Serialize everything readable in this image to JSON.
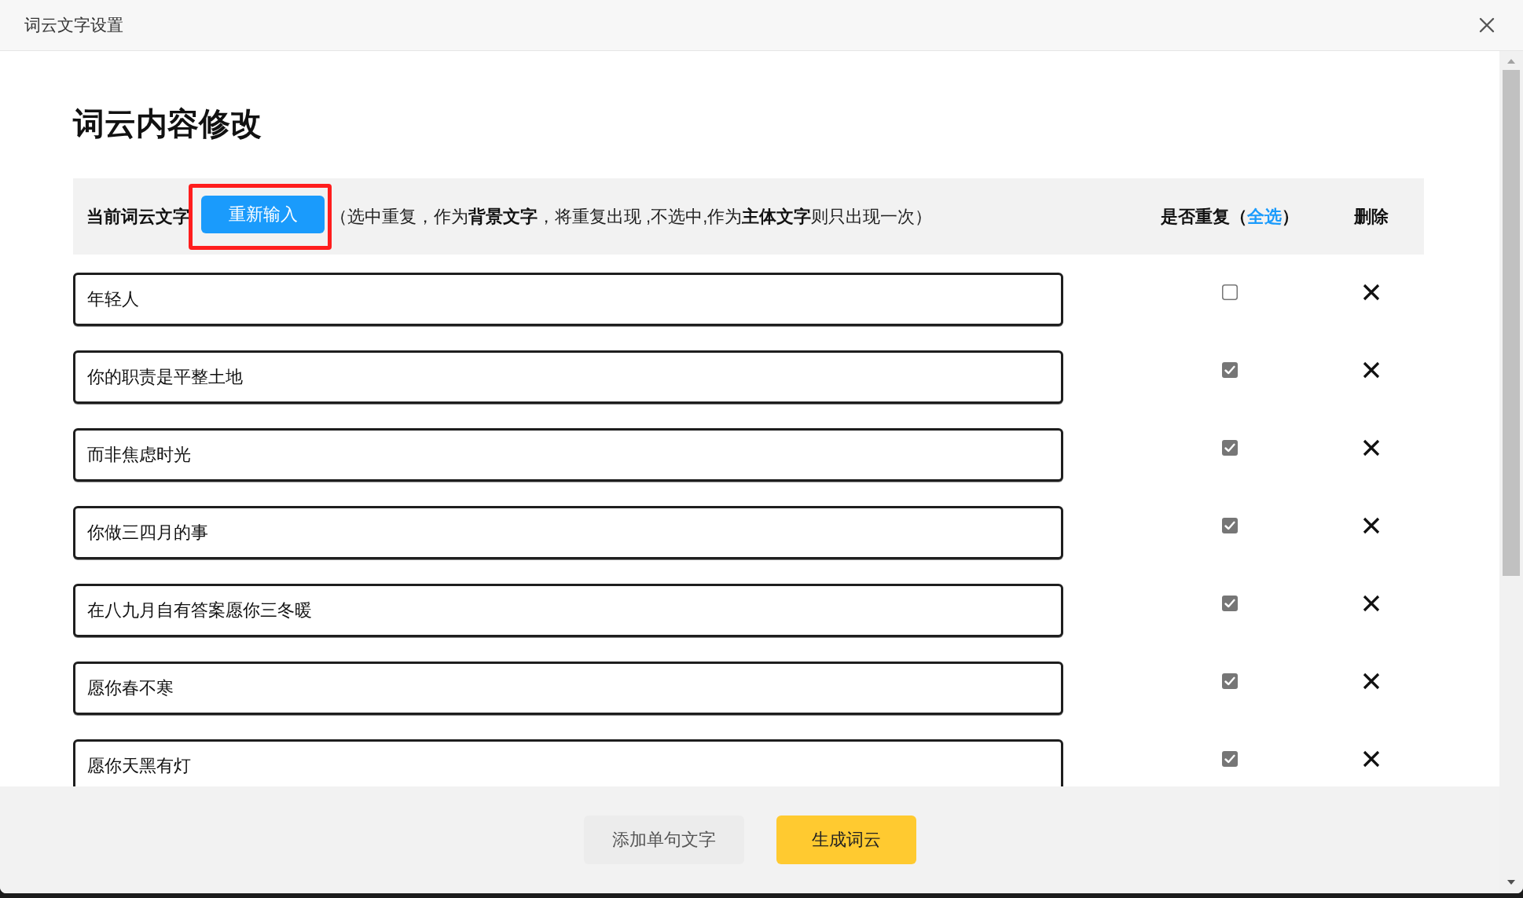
{
  "window": {
    "title": "词云文字设置"
  },
  "heading": "词云内容修改",
  "header_bar": {
    "label": "当前词云文字",
    "reenter_button": {
      "label": "重新输入",
      "highlighted": true
    },
    "hint": "（选中重复，作为**背景文字**，将重复出现 ,不选中,作为**主体文字**则只出现一次）",
    "repeat_header": {
      "label": "是否重复（",
      "select_all": "全选",
      "label_end": "）"
    },
    "delete_header": "删除"
  },
  "rows": [
    {
      "text": "年轻人",
      "checked": false
    },
    {
      "text": "你的职责是平整土地",
      "checked": true
    },
    {
      "text": "而非焦虑时光",
      "checked": true
    },
    {
      "text": "你做三四月的事",
      "checked": true
    },
    {
      "text": "在八九月自有答案愿你三冬暖",
      "checked": true
    },
    {
      "text": "愿你春不寒",
      "checked": true
    },
    {
      "text": "愿你天黑有灯",
      "checked": true
    }
  ],
  "footer": {
    "buttons": [
      {
        "label": "添加单句文字",
        "kind": "secondary"
      },
      {
        "label": "生成词云",
        "kind": "primary"
      }
    ]
  }
}
